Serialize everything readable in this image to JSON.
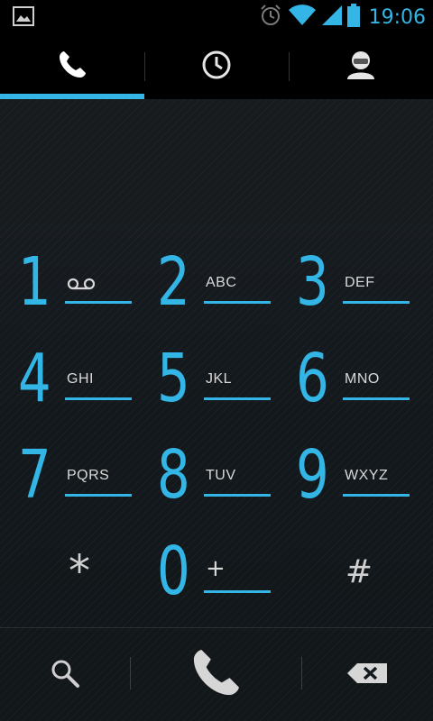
{
  "status_bar": {
    "time": "19:06",
    "icons": [
      "picture-notification-icon",
      "alarm-icon",
      "wifi-icon",
      "signal-icon",
      "battery-icon"
    ]
  },
  "tabs": [
    {
      "icon": "phone-icon",
      "selected": true
    },
    {
      "icon": "clock-icon",
      "selected": false
    },
    {
      "icon": "contact-icon",
      "selected": false
    }
  ],
  "dialer": {
    "digits_value": "",
    "keys": [
      {
        "digit": "1",
        "letters": "",
        "icon": "voicemail-icon"
      },
      {
        "digit": "2",
        "letters": "ABC"
      },
      {
        "digit": "3",
        "letters": "DEF"
      },
      {
        "digit": "4",
        "letters": "GHI"
      },
      {
        "digit": "5",
        "letters": "JKL"
      },
      {
        "digit": "6",
        "letters": "MNO"
      },
      {
        "digit": "7",
        "letters": "PQRS"
      },
      {
        "digit": "8",
        "letters": "TUV"
      },
      {
        "digit": "9",
        "letters": "WXYZ"
      },
      {
        "digit": "*",
        "letters": ""
      },
      {
        "digit": "0",
        "letters": "+"
      },
      {
        "digit": "#",
        "letters": ""
      }
    ]
  },
  "actions": {
    "search_icon": "search-icon",
    "call_icon": "call-icon",
    "delete_icon": "backspace-icon"
  },
  "colors": {
    "accent": "#33b5e5",
    "background": "#14191d",
    "key_letters": "#d9d9d9"
  }
}
